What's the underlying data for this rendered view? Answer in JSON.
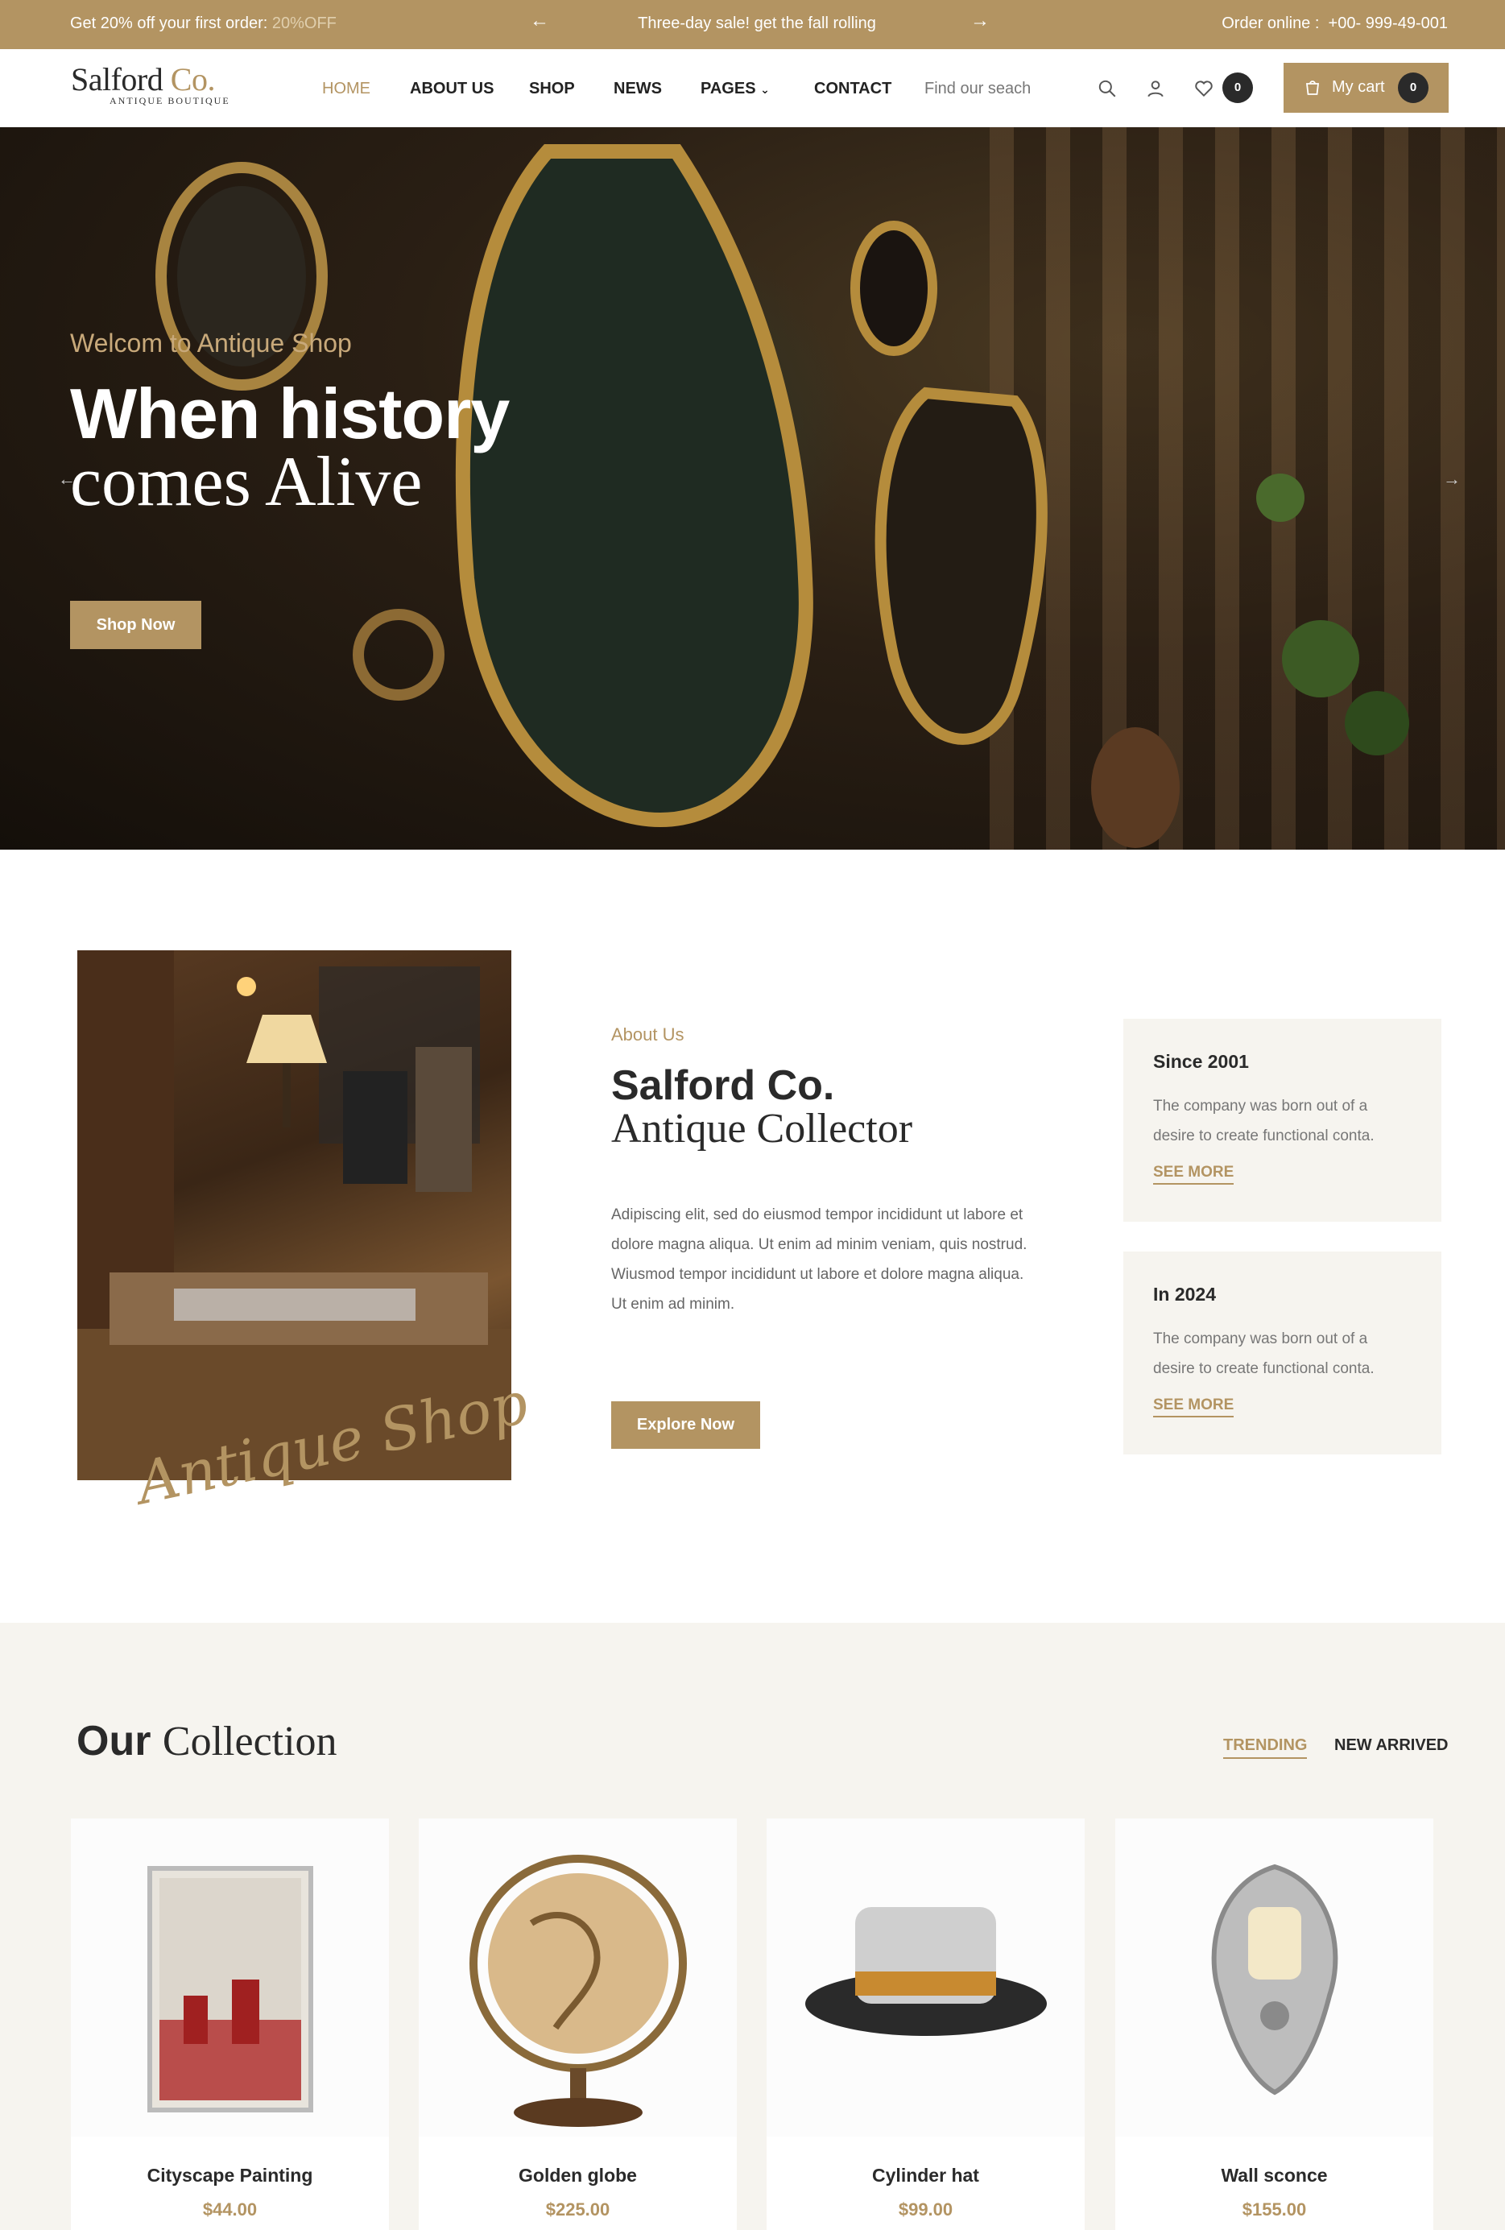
{
  "topbar": {
    "promo_text": "Get 20% off your first order:",
    "promo_code": "20%OFF",
    "sale_text": "Three-day sale! get the fall rolling",
    "phone_label": "Order online :",
    "phone": "+00- 999-49-001"
  },
  "header": {
    "logo_main": "Salford",
    "logo_co": "Co.",
    "logo_sub": "ANTIQUE BOUTIQUE",
    "nav": [
      "HOME",
      "ABOUT US",
      "SHOP",
      "NEWS",
      "PAGES",
      "CONTACT"
    ],
    "search_placeholder": "Find our seach",
    "wishlist_count": "0",
    "cart_label": "My cart",
    "cart_count": "0"
  },
  "hero": {
    "subtitle": "Welcom to Antique Shop",
    "title_line1": "When history",
    "title_line2": "comes Alive",
    "button": "Shop Now"
  },
  "about": {
    "script": "Antique Shop",
    "label": "About Us",
    "title_line1": "Salford Co.",
    "title_line2": "Antique Collector",
    "para1": "Adipiscing elit, sed do eiusmod tempor incididunt ut labore et dolore magna aliqua. Ut enim ad minim veniam, quis nostrud.",
    "para2": "Wiusmod tempor incididunt ut labore et dolore magna aliqua. Ut enim ad minim.",
    "button": "Explore Now",
    "cards": [
      {
        "heading": "Since 2001",
        "text": "The company was born out of a desire to create functional conta.",
        "link": "SEE MORE"
      },
      {
        "heading": "In 2024",
        "text": "The company was born out of a desire to create functional conta.",
        "link": "SEE MORE"
      }
    ]
  },
  "collection": {
    "title_bold": "Our",
    "title_rest": "Collection",
    "tabs": [
      "TRENDING",
      "NEW ARRIVED"
    ],
    "products": [
      {
        "name": "Cityscape Painting",
        "price": "$44.00"
      },
      {
        "name": "Golden globe",
        "price": "$225.00"
      },
      {
        "name": "Cylinder hat",
        "price": "$99.00"
      },
      {
        "name": "Wall sconce",
        "price": "$155.00"
      }
    ]
  },
  "colors": {
    "accent": "#b39462",
    "dark": "#2a2a2a",
    "cream": "#f6f4ef"
  }
}
